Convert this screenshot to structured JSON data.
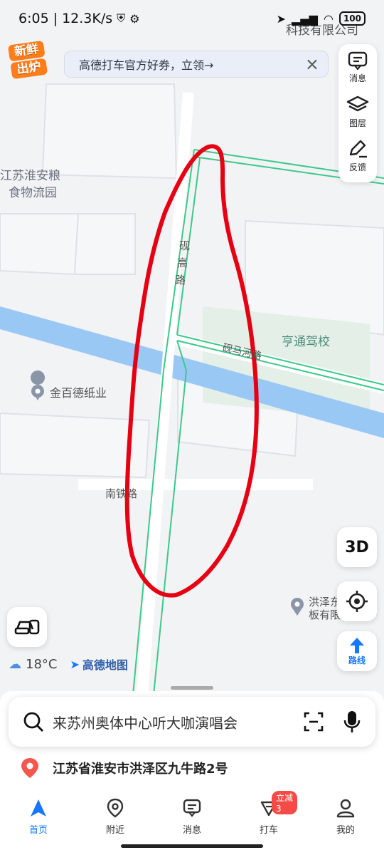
{
  "status_bar": {
    "time": "6:05",
    "net_speed": "12.3K/s",
    "battery": "100"
  },
  "promo_badge": {
    "line1": "新鲜",
    "line2": "出炉"
  },
  "banner": {
    "text": "高德打车官方好券，立领→",
    "close": "×"
  },
  "right_panel": {
    "message": "消息",
    "layers": "图层",
    "feedback": "反馈"
  },
  "map_labels": {
    "top_company": "科技有限公司",
    "warehouse_line1": "江苏淮安粮",
    "warehouse_line2": "食物流园",
    "road_yangao": "砚高路",
    "driving_school": "亨通驾校",
    "road_yanma": "砚马河路",
    "paper_company": "金百德纸业",
    "road_nanzhan": "南铁路",
    "poi_bottom_line1": "洪泽东",
    "poi_bottom_line2": "板有限"
  },
  "controls": {
    "btn_3d": "3D",
    "btn_route": "路线"
  },
  "weather": {
    "temp": "18°C",
    "brand": "高德地图"
  },
  "search": {
    "placeholder": "来苏州奥体中心听大咖演唱会"
  },
  "address": {
    "text": "江苏省淮安市洪泽区九牛路2号"
  },
  "tabs": [
    {
      "label": "首页"
    },
    {
      "label": "附近"
    },
    {
      "label": "消息"
    },
    {
      "label": "打车",
      "badge": "立减3"
    },
    {
      "label": "我的"
    }
  ],
  "colors": {
    "accent": "#1677ff",
    "annotation_stroke": "#e60012",
    "road_outline": "#3cc98a",
    "river": "#9ac8f5"
  }
}
